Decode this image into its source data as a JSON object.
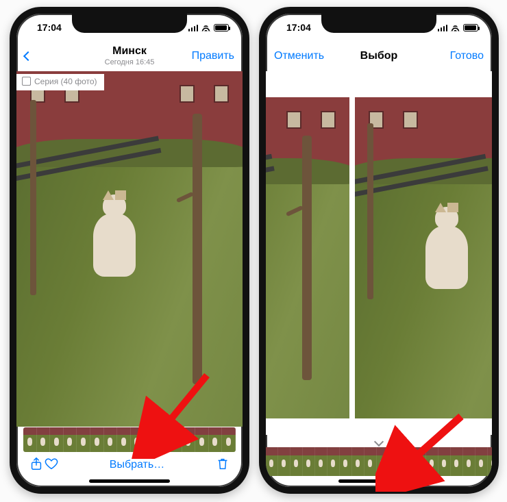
{
  "status": {
    "time": "17:04"
  },
  "left": {
    "nav": {
      "title": "Минск",
      "subtitle": "Сегодня 16:45",
      "edit": "Править"
    },
    "badge": "Серия (40 фото)",
    "toolbar": {
      "select": "Выбрать…"
    },
    "burst_thumb_count_group1": 9,
    "burst_thumb_count_group2": 6
  },
  "right": {
    "nav": {
      "cancel": "Отменить",
      "title": "Выбор",
      "done": "Готово"
    },
    "filmstrip_count": 22
  },
  "colors": {
    "tint": "#007aff"
  }
}
